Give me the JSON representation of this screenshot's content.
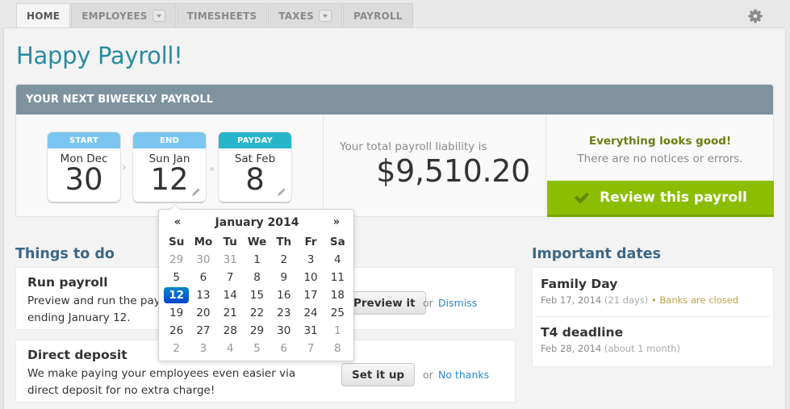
{
  "nav": {
    "tabs": [
      {
        "label": "HOME",
        "active": true,
        "dropdown": false
      },
      {
        "label": "EMPLOYEES",
        "active": false,
        "dropdown": true
      },
      {
        "label": "TIMESHEETS",
        "active": false,
        "dropdown": false
      },
      {
        "label": "TAXES",
        "active": false,
        "dropdown": true
      },
      {
        "label": "PAYROLL",
        "active": false,
        "dropdown": false
      }
    ],
    "settings_icon": "gear-icon"
  },
  "page_title": "Happy Payroll!",
  "next_payroll": {
    "header": "YOUR NEXT BIWEEKLY PAYROLL",
    "start": {
      "label": "START",
      "day": "Mon Dec",
      "date": "30"
    },
    "end": {
      "label": "END",
      "day": "Sun Jan",
      "date": "12"
    },
    "payday": {
      "label": "PAYDAY",
      "day": "Sat Feb",
      "date": "8"
    },
    "liability_label": "Your total payroll liability is",
    "liability_value": "$9,510.20",
    "status_title": "Everything looks good!",
    "status_sub": "There are no notices or errors.",
    "review_button": "Review this payroll"
  },
  "datepicker": {
    "prev": "«",
    "next": "»",
    "title": "January 2014",
    "weekdays": [
      "Su",
      "Mo",
      "Tu",
      "We",
      "Th",
      "Fr",
      "Sa"
    ],
    "selected": "12",
    "weeks": [
      [
        {
          "d": "29",
          "old": true
        },
        {
          "d": "30",
          "old": true
        },
        {
          "d": "31",
          "old": true
        },
        {
          "d": "1"
        },
        {
          "d": "2"
        },
        {
          "d": "3"
        },
        {
          "d": "4"
        }
      ],
      [
        {
          "d": "5"
        },
        {
          "d": "6"
        },
        {
          "d": "7"
        },
        {
          "d": "8"
        },
        {
          "d": "9"
        },
        {
          "d": "10"
        },
        {
          "d": "11"
        }
      ],
      [
        {
          "d": "12",
          "sel": true
        },
        {
          "d": "13"
        },
        {
          "d": "14"
        },
        {
          "d": "15"
        },
        {
          "d": "16"
        },
        {
          "d": "17"
        },
        {
          "d": "18"
        }
      ],
      [
        {
          "d": "19"
        },
        {
          "d": "20"
        },
        {
          "d": "21"
        },
        {
          "d": "22"
        },
        {
          "d": "23"
        },
        {
          "d": "24"
        },
        {
          "d": "25"
        }
      ],
      [
        {
          "d": "26"
        },
        {
          "d": "27"
        },
        {
          "d": "28"
        },
        {
          "d": "29"
        },
        {
          "d": "30"
        },
        {
          "d": "31"
        },
        {
          "d": "1",
          "old": true
        }
      ],
      [
        {
          "d": "2",
          "old": true
        },
        {
          "d": "3",
          "old": true
        },
        {
          "d": "4",
          "old": true
        },
        {
          "d": "5",
          "old": true
        },
        {
          "d": "6",
          "old": true
        },
        {
          "d": "7",
          "old": true
        },
        {
          "d": "8",
          "old": true
        }
      ]
    ]
  },
  "todo": {
    "title": "Things to do",
    "items": [
      {
        "title": "Run payroll",
        "line1": "Preview and run the payroll for the period",
        "line2": "ending January 12.",
        "button": "Preview it",
        "or": "or",
        "link": "Dismiss"
      },
      {
        "title": "Direct deposit",
        "line1": "We make paying your employees even easier via",
        "line2": "direct deposit for no extra charge!",
        "button": "Set it up",
        "or": "or",
        "link": "No thanks"
      }
    ]
  },
  "important_dates": {
    "title": "Important dates",
    "items": [
      {
        "name": "Family Day",
        "date": "Feb 17, 2014",
        "relative": "(21 days)",
        "bullet": "•",
        "note": "Banks are closed"
      },
      {
        "name": "T4 deadline",
        "date": "Feb 28, 2014",
        "relative": "(about 1 month)",
        "bullet": "",
        "note": ""
      }
    ]
  },
  "colors": {
    "title": "#2b8ba1",
    "header_bar": "#7f939f",
    "start_end_tab": "#7ac6f0",
    "payday_tab": "#27b5c9",
    "review_button": "#8bbd03",
    "ok_text": "#6f7d15",
    "link": "#2a8ac9",
    "selected_day": "#0066cc"
  }
}
